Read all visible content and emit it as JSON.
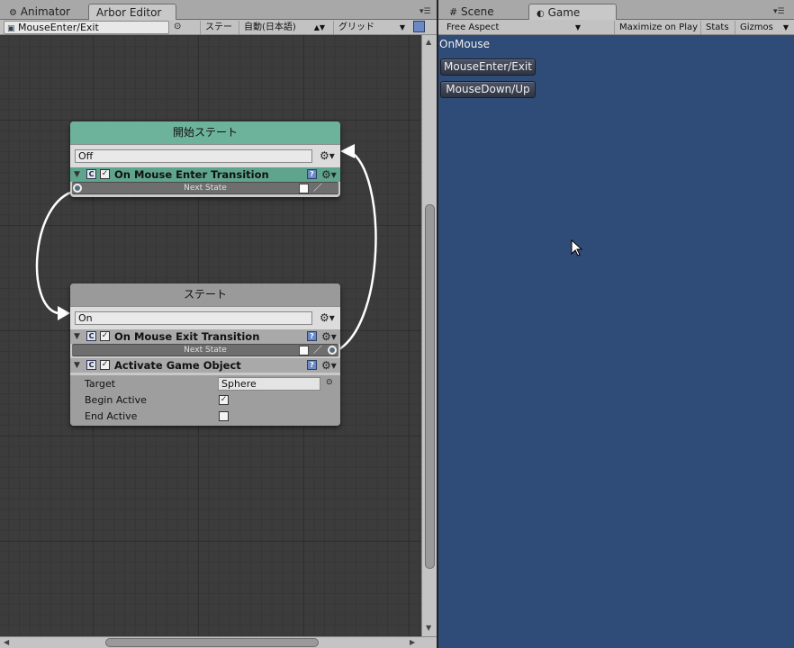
{
  "left_panel": {
    "tabs": [
      {
        "label": "Animator"
      },
      {
        "label": "Arbor Editor"
      }
    ],
    "toolbar": {
      "object_field": "MouseEnter/Exit",
      "state_dropdown": "ステート",
      "language_dropdown": "自動(日本語)",
      "grid_dropdown": "グリッド"
    }
  },
  "right_panel": {
    "tabs": [
      {
        "label": "Scene"
      },
      {
        "label": "Game"
      }
    ],
    "toolbar": {
      "aspect": "Free Aspect",
      "maximize": "Maximize on Play",
      "stats": "Stats",
      "gizmos": "Gizmos"
    }
  },
  "graph": {
    "start_node": {
      "title": "開始ステート",
      "name_value": "Off",
      "behaviour_title": "On Mouse Enter Transition",
      "slot_label": "Next State"
    },
    "state_node": {
      "title": "ステート",
      "name_value": "On",
      "transition_title": "On Mouse Exit Transition",
      "slot_label": "Next State",
      "activate_title": "Activate Game Object",
      "props": {
        "target_label": "Target",
        "target_value": "Sphere",
        "begin_label": "Begin Active",
        "begin_checked": true,
        "end_label": "End Active",
        "end_checked": false
      }
    }
  },
  "game_view": {
    "label": "OnMouse",
    "buttons": [
      {
        "label": "MouseEnter/Exit"
      },
      {
        "label": "MouseDown/Up"
      }
    ]
  },
  "colors": {
    "start_node_header": "#6db39b",
    "game_background": "#2f4b78",
    "editor_background": "#3c3c3c"
  }
}
